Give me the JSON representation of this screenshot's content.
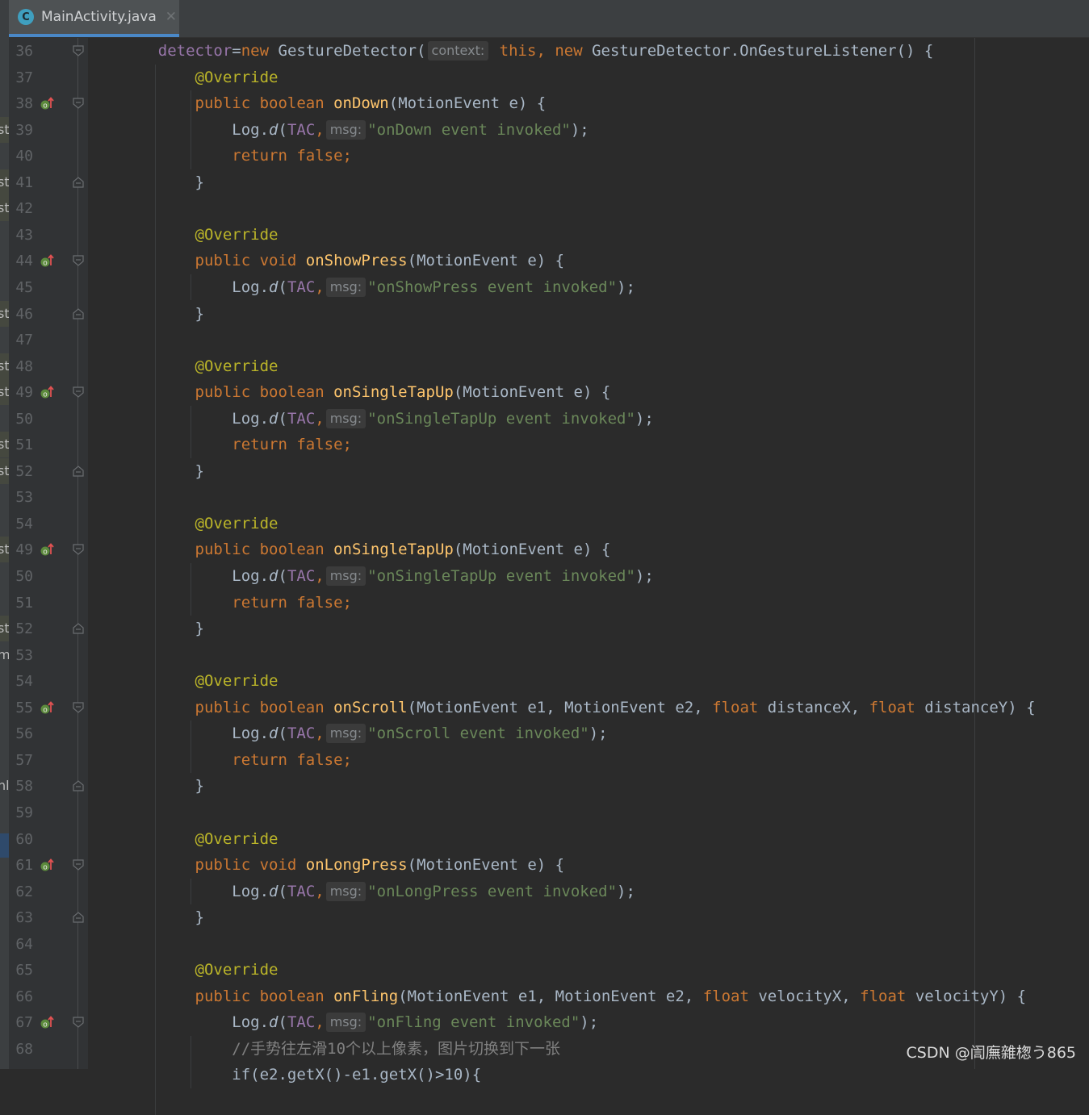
{
  "tab": {
    "title": "MainActivity.java",
    "icon_letter": "C",
    "close_glyph": "✕"
  },
  "left_strip_fragments": [
    "st",
    "st",
    "st",
    "st",
    "st",
    "st",
    "st",
    "st",
    "st",
    "st",
    "m",
    "hl"
  ],
  "rows": [
    {
      "n": "36",
      "segs": [
        [
          "    detector",
          "fld"
        ],
        [
          "=",
          "t"
        ],
        [
          "new ",
          "kw"
        ],
        [
          "GestureDetector(",
          "t"
        ],
        [
          "context:",
          "hint"
        ],
        [
          " this",
          "kw"
        ],
        [
          ", ",
          "kw"
        ],
        [
          "new ",
          "kw"
        ],
        [
          "GestureDetector.OnGestureListener() {",
          "t"
        ]
      ]
    },
    {
      "n": "37",
      "segs": [
        [
          "        ",
          ""
        ],
        [
          "@Override",
          "ann"
        ]
      ]
    },
    {
      "n": "38",
      "segs": [
        [
          "        ",
          ""
        ],
        [
          "public boolean ",
          "kw"
        ],
        [
          "onDown",
          "fn"
        ],
        [
          "(MotionEvent e) {",
          "t"
        ]
      ]
    },
    {
      "n": "39",
      "segs": [
        [
          "            Log.",
          ""
        ],
        [
          "d",
          "it"
        ],
        [
          "(",
          ""
        ],
        [
          "TAC",
          "fld"
        ],
        [
          ",",
          "kw"
        ],
        [
          "msg:",
          "hint"
        ],
        [
          "\"onDown event invoked\"",
          "str"
        ],
        [
          ");",
          "t"
        ]
      ]
    },
    {
      "n": "40",
      "segs": [
        [
          "            ",
          ""
        ],
        [
          "return false;",
          "kw"
        ]
      ]
    },
    {
      "n": "41",
      "segs": [
        [
          "        }",
          ""
        ]
      ]
    },
    {
      "n": "42",
      "segs": []
    },
    {
      "n": "43",
      "segs": [
        [
          "        ",
          ""
        ],
        [
          "@Override",
          "ann"
        ]
      ]
    },
    {
      "n": "44",
      "segs": [
        [
          "        ",
          ""
        ],
        [
          "public void ",
          "kw"
        ],
        [
          "onShowPress",
          "fn"
        ],
        [
          "(MotionEvent e) {",
          "t"
        ]
      ]
    },
    {
      "n": "45",
      "segs": [
        [
          "            Log.",
          ""
        ],
        [
          "d",
          "it"
        ],
        [
          "(",
          ""
        ],
        [
          "TAC",
          "fld"
        ],
        [
          ",",
          "kw"
        ],
        [
          "msg:",
          "hint"
        ],
        [
          "\"onShowPress event invoked\"",
          "str"
        ],
        [
          ");",
          "t"
        ]
      ]
    },
    {
      "n": "46",
      "segs": [
        [
          "        }",
          ""
        ]
      ]
    },
    {
      "n": "47",
      "segs": []
    },
    {
      "n": "48",
      "segs": [
        [
          "        ",
          ""
        ],
        [
          "@Override",
          "ann"
        ]
      ]
    },
    {
      "n": "49",
      "segs": [
        [
          "        ",
          ""
        ],
        [
          "public boolean ",
          "kw"
        ],
        [
          "onSingleTapUp",
          "fn"
        ],
        [
          "(MotionEvent e) {",
          "t"
        ]
      ]
    },
    {
      "n": "50",
      "segs": [
        [
          "            Log.",
          ""
        ],
        [
          "d",
          "it"
        ],
        [
          "(",
          ""
        ],
        [
          "TAC",
          "fld"
        ],
        [
          ",",
          "kw"
        ],
        [
          "msg:",
          "hint"
        ],
        [
          "\"onSingleTapUp event invoked\"",
          "str"
        ],
        [
          ");",
          "t"
        ]
      ]
    },
    {
      "n": "51",
      "segs": [
        [
          "            ",
          ""
        ],
        [
          "return false;",
          "kw"
        ]
      ]
    },
    {
      "n": "52",
      "segs": [
        [
          "        }",
          ""
        ]
      ]
    },
    {
      "n": "53",
      "segs": []
    },
    {
      "n": "54",
      "segs": [
        [
          "        ",
          ""
        ],
        [
          "@Override",
          "ann"
        ]
      ]
    },
    {
      "n": "49",
      "segs": [
        [
          "        ",
          ""
        ],
        [
          "public boolean ",
          "kw"
        ],
        [
          "onSingleTapUp",
          "fn"
        ],
        [
          "(MotionEvent e) {",
          "t"
        ]
      ]
    },
    {
      "n": "50",
      "segs": [
        [
          "            Log.",
          ""
        ],
        [
          "d",
          "it"
        ],
        [
          "(",
          ""
        ],
        [
          "TAC",
          "fld"
        ],
        [
          ",",
          "kw"
        ],
        [
          "msg:",
          "hint"
        ],
        [
          "\"onSingleTapUp event invoked\"",
          "str"
        ],
        [
          ");",
          "t"
        ]
      ]
    },
    {
      "n": "51",
      "segs": [
        [
          "            ",
          ""
        ],
        [
          "return false;",
          "kw"
        ]
      ]
    },
    {
      "n": "52",
      "segs": [
        [
          "        }",
          ""
        ]
      ]
    },
    {
      "n": "53",
      "segs": []
    },
    {
      "n": "54",
      "segs": [
        [
          "        ",
          ""
        ],
        [
          "@Override",
          "ann"
        ]
      ]
    },
    {
      "n": "55",
      "segs": [
        [
          "        ",
          ""
        ],
        [
          "public boolean ",
          "kw"
        ],
        [
          "onScroll",
          "fn"
        ],
        [
          "(MotionEvent e1, MotionEvent e2, ",
          "t"
        ],
        [
          "float ",
          "kw"
        ],
        [
          "distanceX, ",
          "t"
        ],
        [
          "float ",
          "kw"
        ],
        [
          "distanceY) {",
          "t"
        ]
      ]
    },
    {
      "n": "56",
      "segs": [
        [
          "            Log.",
          ""
        ],
        [
          "d",
          "it"
        ],
        [
          "(",
          ""
        ],
        [
          "TAC",
          "fld"
        ],
        [
          ",",
          "kw"
        ],
        [
          "msg:",
          "hint"
        ],
        [
          "\"onScroll event invoked\"",
          "str"
        ],
        [
          ");",
          "t"
        ]
      ]
    },
    {
      "n": "57",
      "segs": [
        [
          "            ",
          ""
        ],
        [
          "return false;",
          "kw"
        ]
      ]
    },
    {
      "n": "58",
      "segs": [
        [
          "        }",
          ""
        ]
      ]
    },
    {
      "n": "59",
      "segs": []
    },
    {
      "n": "60",
      "segs": [
        [
          "        ",
          ""
        ],
        [
          "@Override",
          "ann"
        ]
      ]
    },
    {
      "n": "61",
      "segs": [
        [
          "        ",
          ""
        ],
        [
          "public void ",
          "kw"
        ],
        [
          "onLongPress",
          "fn"
        ],
        [
          "(MotionEvent e) {",
          "t"
        ]
      ]
    },
    {
      "n": "62",
      "segs": [
        [
          "            Log.",
          ""
        ],
        [
          "d",
          "it"
        ],
        [
          "(",
          ""
        ],
        [
          "TAC",
          "fld"
        ],
        [
          ",",
          "kw"
        ],
        [
          "msg:",
          "hint"
        ],
        [
          "\"onLongPress event invoked\"",
          "str"
        ],
        [
          ");",
          "t"
        ]
      ]
    },
    {
      "n": "63",
      "segs": [
        [
          "        }",
          ""
        ]
      ]
    },
    {
      "n": "64",
      "segs": []
    },
    {
      "n": "65",
      "segs": [
        [
          "        ",
          ""
        ],
        [
          "@Override",
          "ann"
        ]
      ]
    },
    {
      "n": "66",
      "segs": [
        [
          "        ",
          ""
        ],
        [
          "public boolean ",
          "kw"
        ],
        [
          "onFling",
          "fn"
        ],
        [
          "(MotionEvent e1, MotionEvent e2, ",
          "t"
        ],
        [
          "float ",
          "kw"
        ],
        [
          "velocityX, ",
          "t"
        ],
        [
          "float ",
          "kw"
        ],
        [
          "velocityY) {",
          "t"
        ]
      ]
    },
    {
      "n": "67",
      "segs": [
        [
          "            Log.",
          ""
        ],
        [
          "d",
          "it"
        ],
        [
          "(",
          ""
        ],
        [
          "TAC",
          "fld"
        ],
        [
          ",",
          "kw"
        ],
        [
          "msg:",
          "hint"
        ],
        [
          "\"onFling event invoked\"",
          "str"
        ],
        [
          ");",
          "t"
        ]
      ]
    },
    {
      "n": "68",
      "segs": [
        [
          "            ",
          ""
        ],
        [
          "//手势往左滑10个以上像素，图片切换到下一张",
          "cmt"
        ]
      ]
    },
    {
      "n": "",
      "segs": [
        [
          "            ",
          ""
        ],
        [
          "if(e2.getX()-e1.getX()>10){",
          "t"
        ]
      ]
    }
  ],
  "override_marker_rows": [
    2,
    8,
    13,
    19,
    25,
    31,
    37
  ],
  "fold_open_rows": [
    0,
    2,
    8,
    13,
    19,
    25,
    31,
    37
  ],
  "fold_close_rows": [
    5,
    10,
    16,
    22,
    28,
    33
  ],
  "watermark": "CSDN @訚廡雜楤う865",
  "colors": {
    "background": "#2b2b2b",
    "gutter": "#313335",
    "keyword": "#cc7832",
    "annotation": "#bbb529",
    "method": "#ffc66d",
    "string": "#6a8759",
    "field": "#9876aa",
    "comment": "#808080",
    "text": "#a9b7c6",
    "tab_accent": "#4a88c7"
  }
}
